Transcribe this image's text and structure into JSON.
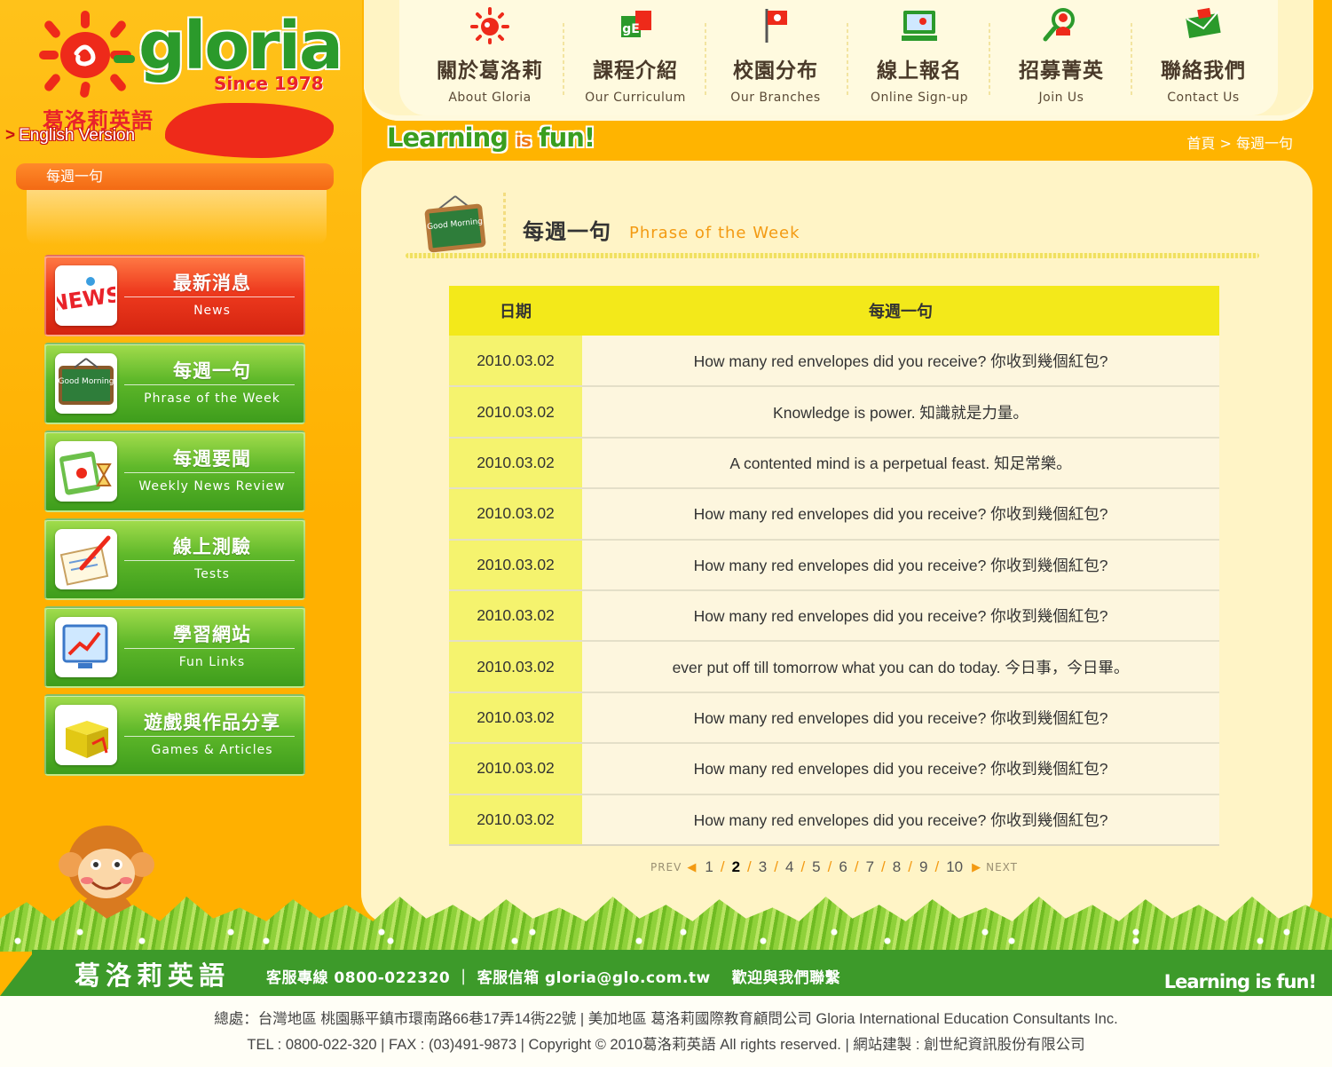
{
  "brand": {
    "logo_text": "gloria",
    "since": "Since 1978",
    "name_zh": "葛洛莉英語",
    "english_link": "English Version"
  },
  "sidebar": {
    "current_section": "每週一句",
    "menu": [
      {
        "zh": "最新消息",
        "en": "News",
        "icon": "news-icon",
        "color": "#e9321a"
      },
      {
        "zh": "每週一句",
        "en": "Phrase of the Week",
        "icon": "chalkboard-icon",
        "icon_text": "Good Morning",
        "color": "#4ea82a"
      },
      {
        "zh": "每週要聞",
        "en": "Weekly News Review",
        "icon": "calendar-hourglass-icon",
        "color": "#4ea82a"
      },
      {
        "zh": "線上測驗",
        "en": "Tests",
        "icon": "test-paper-icon",
        "color": "#4ea82a"
      },
      {
        "zh": "學習網站",
        "en": "Fun Links",
        "icon": "monitor-chart-icon",
        "color": "#4ea82a"
      },
      {
        "zh": "遊戲與作品分享",
        "en": "Games & Articles",
        "icon": "gift-box-icon",
        "color": "#4ea82a"
      }
    ]
  },
  "nav": [
    {
      "zh": "關於葛洛莉",
      "en": "About Gloria",
      "icon": "sun-icon"
    },
    {
      "zh": "課程介紹",
      "en": "Our Curriculum",
      "icon": "curriculum-icon",
      "icon_text": "gE"
    },
    {
      "zh": "校園分布",
      "en": "Our Branches",
      "icon": "flag-icon"
    },
    {
      "zh": "線上報名",
      "en": "Online Sign-up",
      "icon": "computer-icon"
    },
    {
      "zh": "招募菁英",
      "en": "Join Us",
      "icon": "person-search-icon"
    },
    {
      "zh": "聯絡我們",
      "en": "Contact Us",
      "icon": "envelope-icon"
    }
  ],
  "slogan": {
    "a": "Learning",
    "b": "is",
    "c": "fun!"
  },
  "breadcrumb": "首頁 > 每週一句",
  "main": {
    "title": "每週一句",
    "subtitle": "Phrase of the Week",
    "board_text": "Good Morning",
    "columns": [
      "日期",
      "每週一句"
    ],
    "rows": [
      {
        "date": "2010.03.02",
        "text": "How many red envelopes did you receive? 你收到幾個紅包?"
      },
      {
        "date": "2010.03.02",
        "text": "Knowledge is power. 知識就是力量。"
      },
      {
        "date": "2010.03.02",
        "text": "A contented mind is a perpetual feast. 知足常樂。"
      },
      {
        "date": "2010.03.02",
        "text": "How many red envelopes did you receive? 你收到幾個紅包?"
      },
      {
        "date": "2010.03.02",
        "text": "How many red envelopes did you receive? 你收到幾個紅包?"
      },
      {
        "date": "2010.03.02",
        "text": "How many red envelopes did you receive? 你收到幾個紅包?"
      },
      {
        "date": "2010.03.02",
        "text": "ever put off till tomorrow what you can do today. 今日事，今日畢。"
      },
      {
        "date": "2010.03.02",
        "text": "How many red envelopes did you receive? 你收到幾個紅包?"
      },
      {
        "date": "2010.03.02",
        "text": "How many red envelopes did you receive? 你收到幾個紅包?"
      },
      {
        "date": "2010.03.02",
        "text": "How many red envelopes did you receive? 你收到幾個紅包?"
      }
    ]
  },
  "pager": {
    "prev": "PREV",
    "next": "NEXT",
    "pages": [
      "1",
      "2",
      "3",
      "4",
      "5",
      "6",
      "7",
      "8",
      "9",
      "10"
    ],
    "current": "2"
  },
  "footer": {
    "brand": "葛洛莉英語",
    "contact": "客服專線 0800-022320 ｜ 客服信箱 gloria@glo.com.tw　 歡迎與我們聯繫",
    "slogan": "Learning is fun!",
    "address": "總處：台灣地區 桃園縣平鎮市環南路66巷17弄14衖22號 | 美加地區 葛洛莉國際教育顧問公司 Gloria International Education Consultants Inc.",
    "copyright": "TEL : 0800-022-320 | FAX : (03)491-9873 | Copyright © 2010葛洛莉英語 All rights reserved. | 網站建製 : 創世紀資訊股份有限公司"
  },
  "colors": {
    "background": "#ffb400",
    "accent_green": "#3d9a2a",
    "accent_red": "#e9232a",
    "table_header": "#f3e91a",
    "panel": "#fff4c6"
  }
}
